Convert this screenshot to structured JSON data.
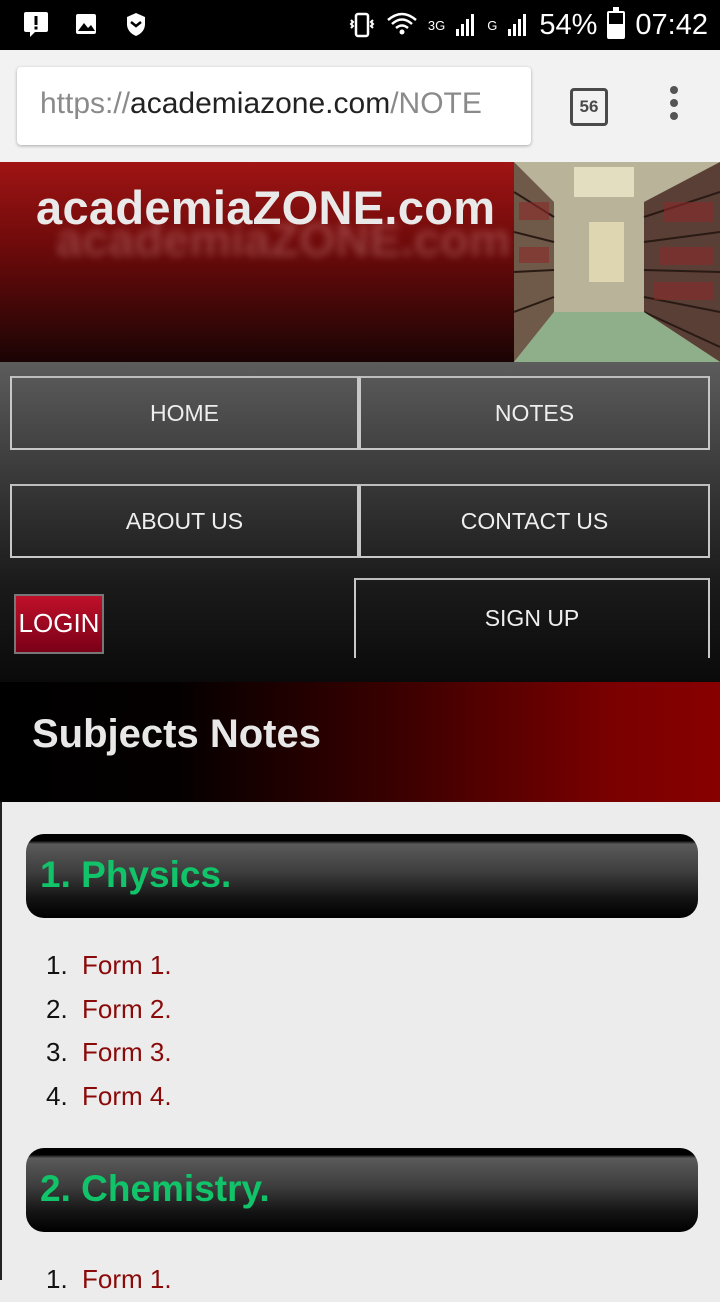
{
  "status_bar": {
    "battery": "54%",
    "time": "07:42",
    "network": "3G",
    "network2": "G",
    "icons": [
      "alert-icon",
      "image-icon",
      "shield-icon",
      "vibrate-icon",
      "wifi-icon",
      "signal-icon",
      "battery-icon"
    ]
  },
  "browser": {
    "url_scheme": "https://",
    "url_host": "academiazone.com",
    "url_path": "/NOTE",
    "tab_count": "56"
  },
  "site": {
    "title": "academiaZONE.com"
  },
  "nav": {
    "home": "HOME",
    "notes": "NOTES",
    "about": "ABOUT US",
    "contact": "CONTACT US",
    "login": "LOGIN",
    "signup": "SIGN UP"
  },
  "page": {
    "heading": "Subjects Notes"
  },
  "subjects": [
    {
      "title": "1. Physics.",
      "items": [
        {
          "num": "1.",
          "label": "Form 1."
        },
        {
          "num": "2.",
          "label": "Form 2."
        },
        {
          "num": "3.",
          "label": "Form 3."
        },
        {
          "num": "4.",
          "label": "Form 4."
        }
      ]
    },
    {
      "title": "2. Chemistry.",
      "items": [
        {
          "num": "1.",
          "label": "Form 1."
        }
      ]
    }
  ],
  "colors": {
    "brand_red": "#8a0a0a",
    "subject_green": "#11c46a"
  }
}
